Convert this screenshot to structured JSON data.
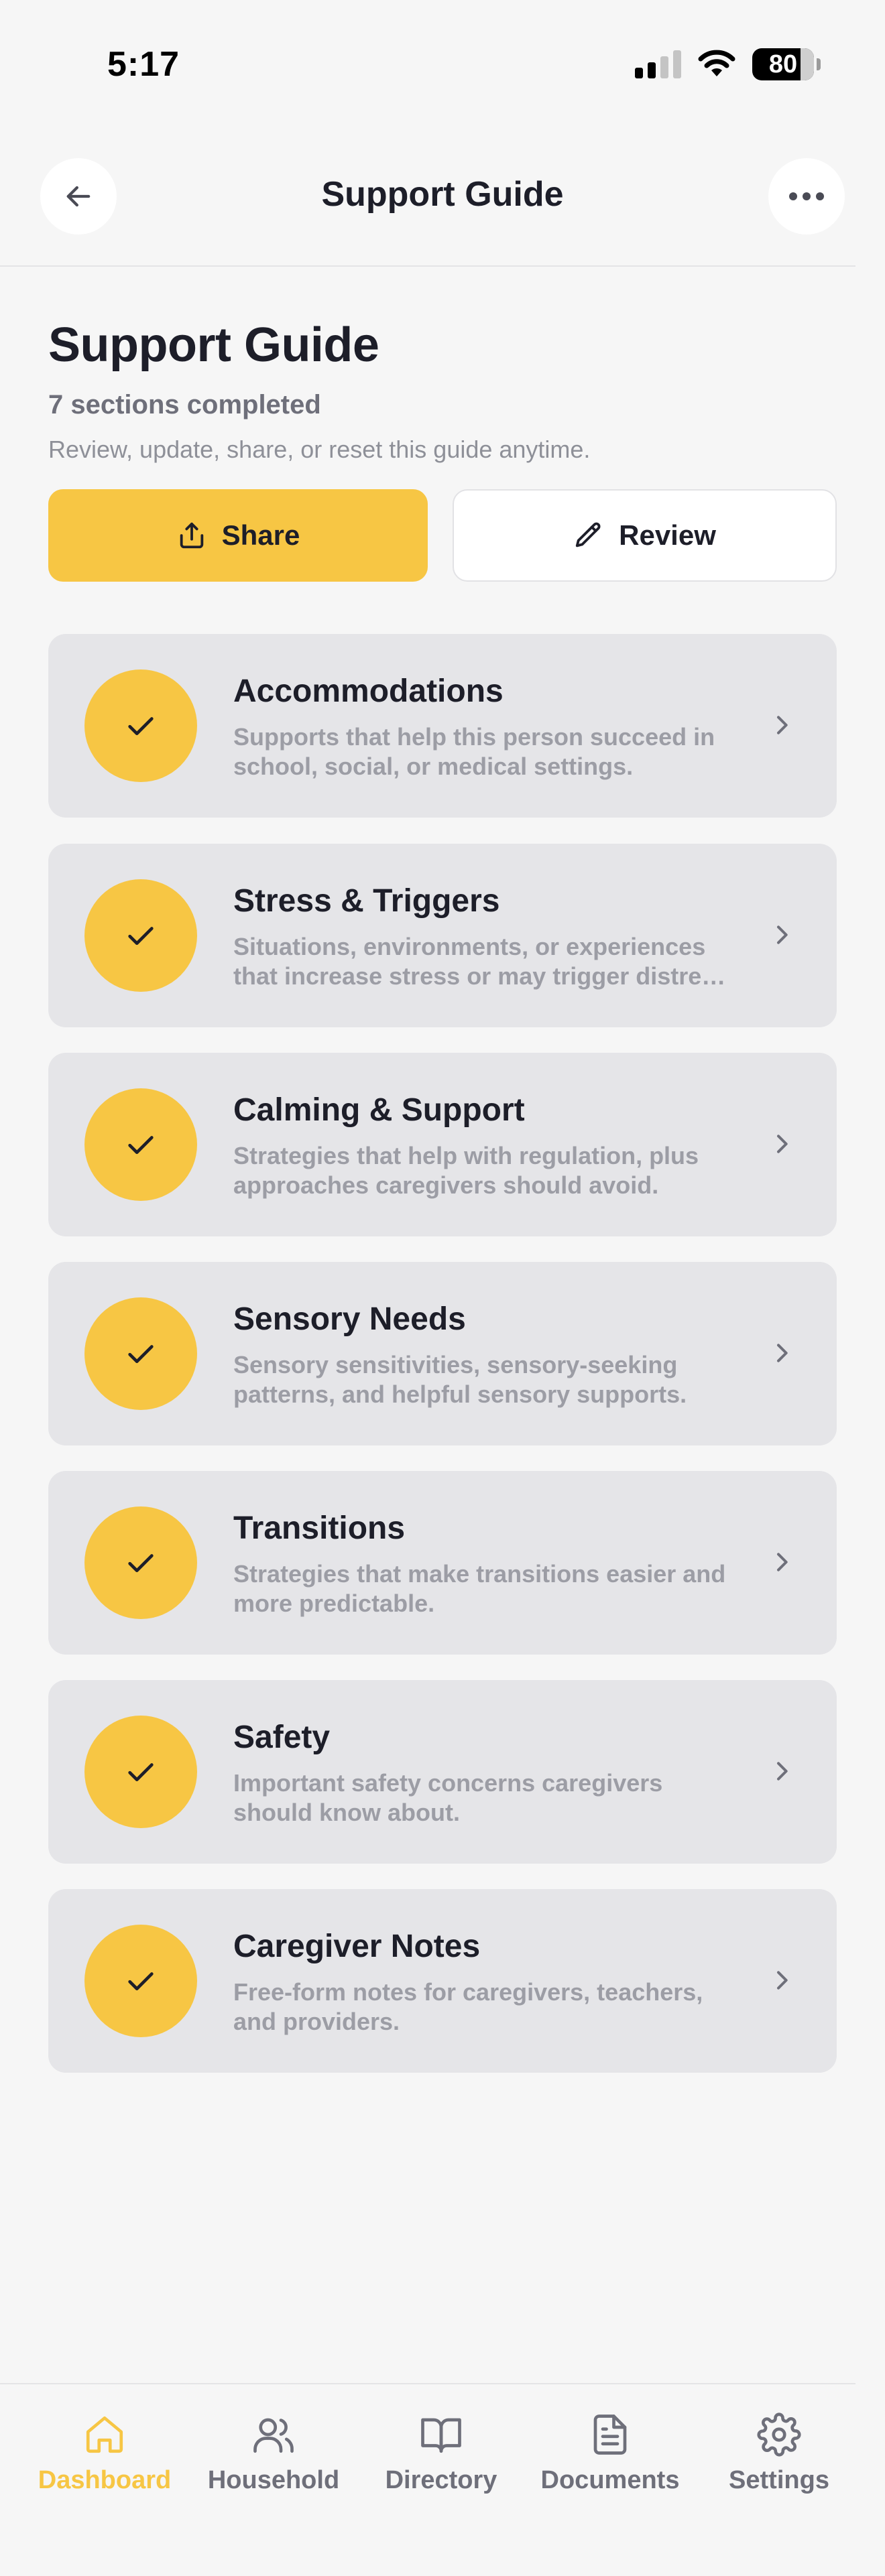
{
  "status_bar": {
    "time": "5:17",
    "battery_level": "80"
  },
  "nav": {
    "title": "Support Guide"
  },
  "header": {
    "title": "Support Guide",
    "subtitle": "7 sections completed",
    "helper": "Review, update, share, or reset this guide anytime."
  },
  "actions": {
    "share_label": "Share",
    "review_label": "Review"
  },
  "sections": [
    {
      "title": "Accommodations",
      "description": "Supports that help this person succeed in school, social, or medical settings.",
      "completed": true
    },
    {
      "title": "Stress & Triggers",
      "description": "Situations, environments, or experiences that increase stress or may trigger distre…",
      "completed": true
    },
    {
      "title": "Calming & Support",
      "description": "Strategies that help with regulation, plus approaches caregivers should avoid.",
      "completed": true
    },
    {
      "title": "Sensory Needs",
      "description": "Sensory sensitivities, sensory-seeking patterns, and helpful sensory supports.",
      "completed": true
    },
    {
      "title": "Transitions",
      "description": "Strategies that make transitions easier and more predictable.",
      "completed": true
    },
    {
      "title": "Safety",
      "description": "Important safety concerns caregivers should know about.",
      "completed": true
    },
    {
      "title": "Caregiver Notes",
      "description": "Free-form notes for caregivers, teachers, and providers.",
      "completed": true
    }
  ],
  "tabs": [
    {
      "label": "Dashboard",
      "icon": "home-icon",
      "active": true
    },
    {
      "label": "Household",
      "icon": "users-icon",
      "active": false
    },
    {
      "label": "Directory",
      "icon": "book-icon",
      "active": false
    },
    {
      "label": "Documents",
      "icon": "document-icon",
      "active": false
    },
    {
      "label": "Settings",
      "icon": "gear-icon",
      "active": false
    }
  ],
  "colors": {
    "accent": "#f7c644",
    "background": "#f6f6f6",
    "card": "#e5e5e8",
    "text": "#1d1e29",
    "muted": "#9c9da5"
  }
}
